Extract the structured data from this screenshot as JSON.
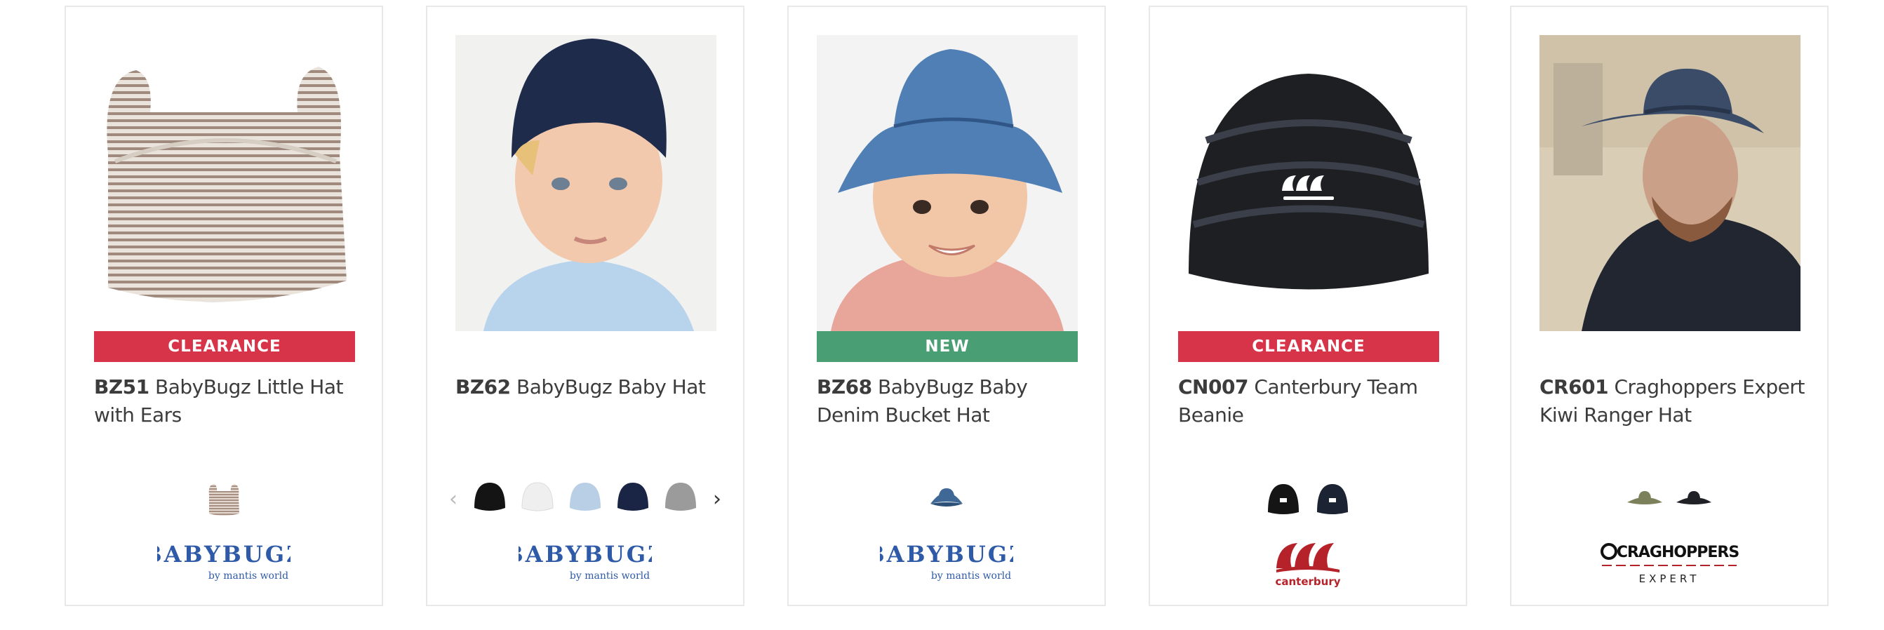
{
  "products": [
    {
      "code": "BZ51",
      "name": "BabyBugz Little Hat with Ears",
      "badge": "CLEARANCE",
      "brand": {
        "name": "BABYBUGZ",
        "sub": "by mantis world"
      },
      "swatches": [
        "oatmeal-stripe"
      ]
    },
    {
      "code": "BZ62",
      "name": "BabyBugz Baby Hat",
      "badge": "",
      "brand": {
        "name": "BABYBUGZ",
        "sub": "by mantis world"
      },
      "swatches": [
        "black",
        "white",
        "pale-blue",
        "navy",
        "grey"
      ]
    },
    {
      "code": "BZ68",
      "name": "BabyBugz Baby Denim Bucket Hat",
      "badge": "NEW",
      "brand": {
        "name": "BABYBUGZ",
        "sub": "by mantis world"
      },
      "swatches": [
        "denim"
      ]
    },
    {
      "code": "CN007",
      "name": "Canterbury Team Beanie",
      "badge": "CLEARANCE",
      "brand": {
        "name": "canterbury",
        "sub": ""
      },
      "swatches": [
        "black",
        "navy"
      ]
    },
    {
      "code": "CR601",
      "name": "Craghoppers Expert Kiwi Ranger Hat",
      "badge": "",
      "brand": {
        "name": "CRAGHOPPERS",
        "sub": "EXPERT"
      },
      "swatches": [
        "olive",
        "black"
      ]
    }
  ],
  "carousel": {
    "prev_icon": "chevron-left-icon",
    "next_icon": "chevron-right-icon",
    "prev": "‹",
    "next": "›"
  },
  "colors": {
    "clearance": "#d7344a",
    "new": "#4a9e74",
    "babybugz_blue": "#2e5aa8",
    "canterbury_red": "#b5222a",
    "border": "#e8e8e8"
  }
}
